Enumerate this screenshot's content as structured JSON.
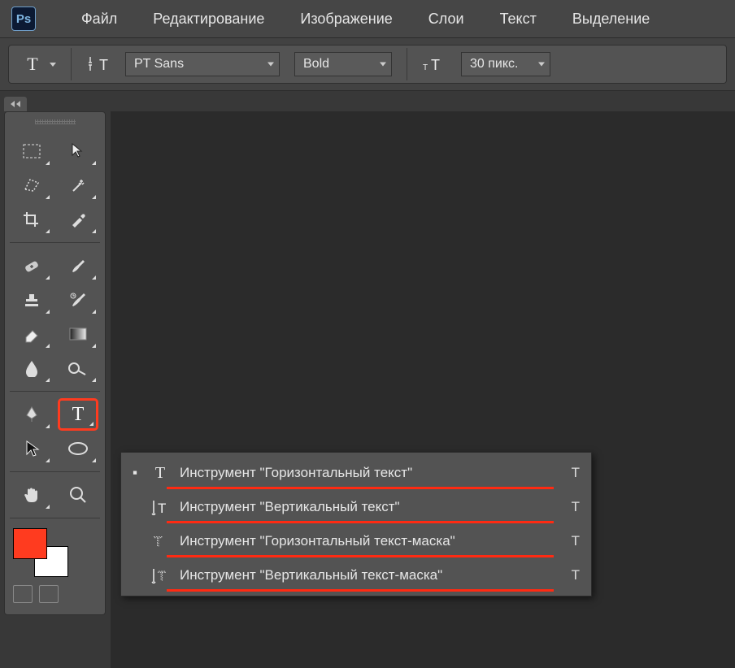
{
  "app": {
    "logo_text": "Ps"
  },
  "menu": {
    "file": "Файл",
    "edit": "Редактирование",
    "image": "Изображение",
    "layers": "Слои",
    "text": "Текст",
    "select": "Выделение"
  },
  "options": {
    "tool_glyph": "T",
    "orientation_glyph": "T",
    "font_family": "PT Sans",
    "font_style": "Bold",
    "size_glyph": "T",
    "font_size": "30 пикс."
  },
  "flyout": {
    "items": [
      {
        "active": true,
        "icon": "T",
        "label": "Инструмент \"Горизонтальный текст\"",
        "shortcut": "T"
      },
      {
        "active": false,
        "icon": "vT",
        "label": "Инструмент \"Вертикальный текст\"",
        "shortcut": "T"
      },
      {
        "active": false,
        "icon": "maskH",
        "label": "Инструмент \"Горизонтальный текст-маска\"",
        "shortcut": "T"
      },
      {
        "active": false,
        "icon": "maskV",
        "label": "Инструмент \"Вертикальный текст-маска\"",
        "shortcut": "T"
      }
    ]
  },
  "colors": {
    "foreground": "#ff3b1f",
    "background": "#ffffff",
    "highlight": "#ff3b1f"
  }
}
